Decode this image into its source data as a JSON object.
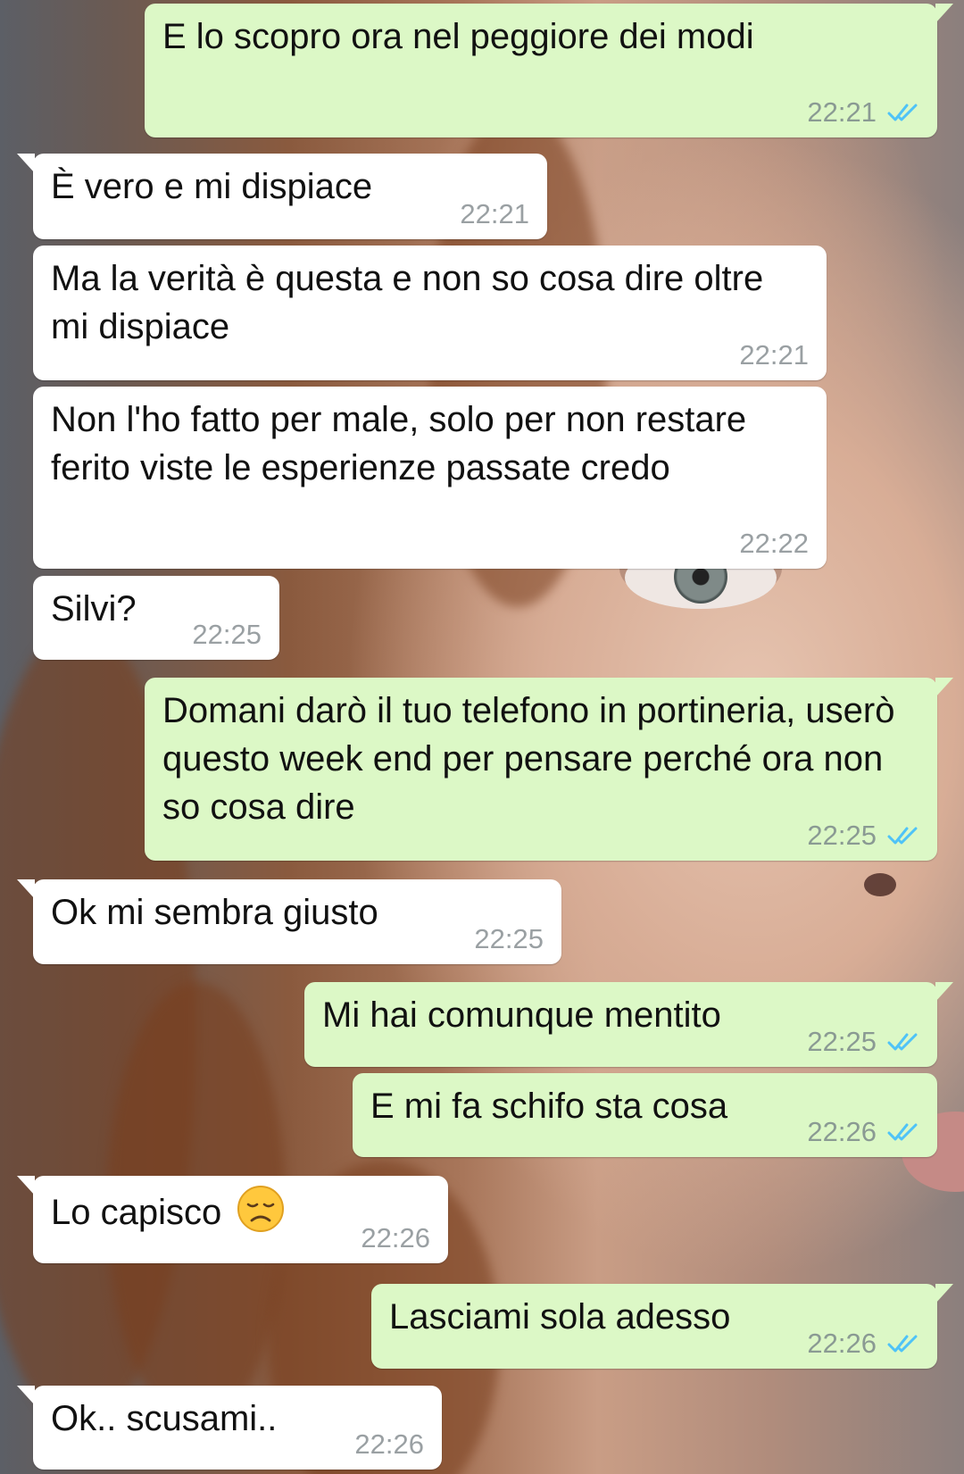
{
  "colors": {
    "incoming_bubble": "#ffffff",
    "outgoing_bubble": "#dcf8c6",
    "read_ticks": "#4fc3f7",
    "timestamp": "#8a9a93"
  },
  "messages": [
    {
      "direction": "outgoing",
      "text": "E lo scopro ora nel peggiore dei modi",
      "time": "22:21",
      "status": "read"
    },
    {
      "direction": "incoming",
      "text": "È vero e mi dispiace",
      "time": "22:21"
    },
    {
      "direction": "incoming",
      "text": "Ma la verità è questa e non so cosa dire oltre mi dispiace",
      "time": "22:21"
    },
    {
      "direction": "incoming",
      "text": "Non l'ho fatto per male, solo per non restare ferito viste le esperienze passate credo",
      "time": "22:22"
    },
    {
      "direction": "incoming",
      "text": "Silvi?",
      "time": "22:25"
    },
    {
      "direction": "outgoing",
      "text": "Domani darò il tuo telefono in portineria, userò questo week end per pensare perché ora non so cosa dire",
      "time": "22:25",
      "status": "read"
    },
    {
      "direction": "incoming",
      "text": "Ok mi sembra giusto",
      "time": "22:25"
    },
    {
      "direction": "outgoing",
      "text": "Mi hai comunque mentito",
      "time": "22:25",
      "status": "read"
    },
    {
      "direction": "outgoing",
      "text": "E mi fa schifo sta cosa",
      "time": "22:26",
      "status": "read"
    },
    {
      "direction": "incoming",
      "text": "Lo capisco",
      "emoji": "disappointed-face",
      "time": "22:26"
    },
    {
      "direction": "outgoing",
      "text": "Lasciami sola adesso",
      "time": "22:26",
      "status": "read"
    },
    {
      "direction": "incoming",
      "text": "Ok.. scusami..",
      "time": "22:26"
    }
  ]
}
